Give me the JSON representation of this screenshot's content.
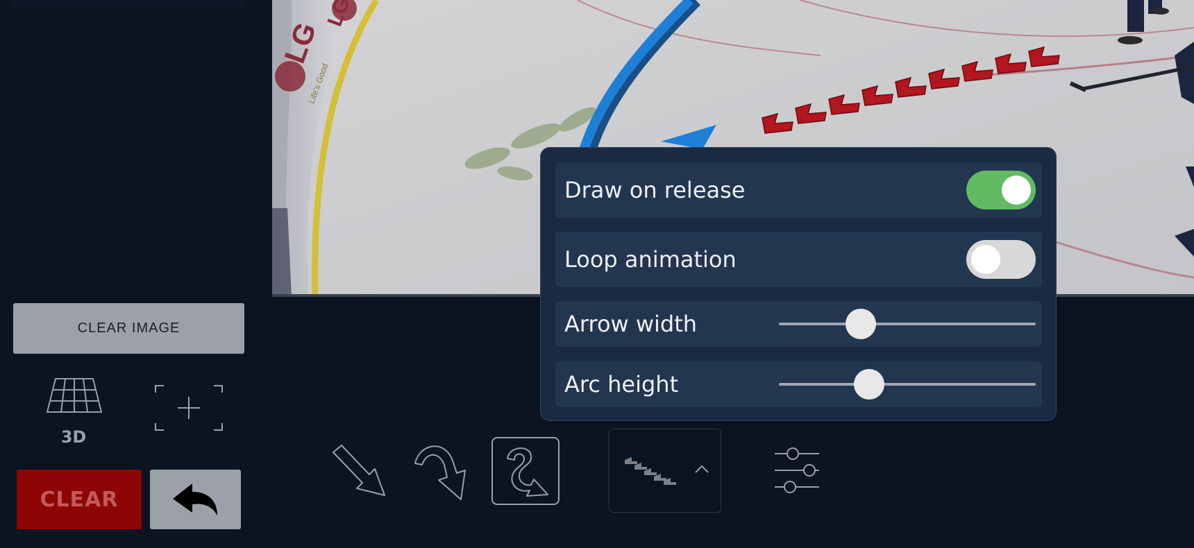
{
  "left_panel": {
    "clear_image_label": "CLEAR IMAGE",
    "view_3d_label": "3D",
    "view_3d_icon": "perspective-grid-icon",
    "fit_icon": "crosshair-frame-icon",
    "clear_label": "CLEAR",
    "undo_icon": "undo-arrow-icon"
  },
  "rink_image": {
    "board_ad_text": [
      "LG",
      "LG",
      "Life's Good"
    ]
  },
  "settings": {
    "draw_on_release": {
      "label": "Draw on release",
      "enabled": true
    },
    "loop_animation": {
      "label": "Loop animation",
      "enabled": false
    },
    "arrow_width": {
      "label": "Arrow width",
      "level": 0.32
    },
    "arc_height": {
      "label": "Arc height",
      "level": 0.35
    }
  },
  "toolbar": {
    "tools": [
      {
        "name": "straight-arrow-tool",
        "icon": "straight-arrow-icon",
        "selected": false
      },
      {
        "name": "curved-arrow-tool",
        "icon": "curved-arrow-icon",
        "selected": false
      },
      {
        "name": "squiggle-arrow-tool",
        "icon": "squiggle-arrow-icon",
        "selected": true
      }
    ],
    "style_picker_icon": "steps-trail-icon",
    "style_picker_chevron": "chevron-up-icon",
    "settings_icon": "sliders-icon"
  },
  "colors": {
    "background": "#0b1420",
    "panel": "#1a2a40",
    "row": "#223650",
    "toggle_on": "#62bb62",
    "toggle_off": "#d8d8d8",
    "clear_button": "#8e0506",
    "gray_button": "#9ca1a9",
    "arrow_blue": "#1e7fd6",
    "step_red": "#b3161e"
  }
}
